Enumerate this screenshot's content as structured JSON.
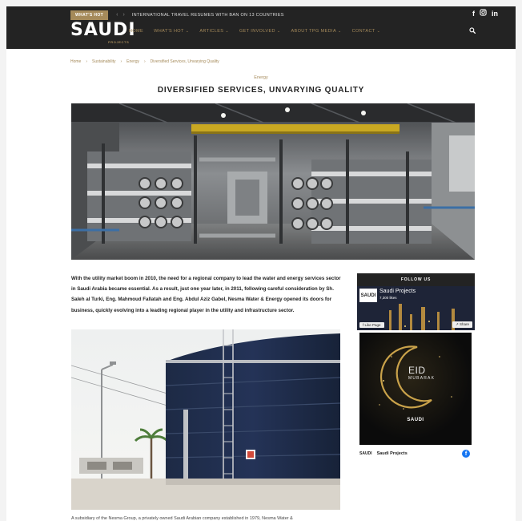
{
  "header": {
    "hot_badge": "WHAT'S HOT",
    "ticker_text": "INTERNATIONAL TRAVEL RESUMES WITH BAN ON 13 COUNTRIES",
    "logo_text": "SAUDI",
    "logo_sub": "PROJECTS",
    "nav": [
      {
        "label": "HOME",
        "has_dropdown": false
      },
      {
        "label": "WHAT'S HOT",
        "has_dropdown": true
      },
      {
        "label": "ARTICLES",
        "has_dropdown": true
      },
      {
        "label": "GET INVOLVED",
        "has_dropdown": true
      },
      {
        "label": "ABOUT TPG MEDIA",
        "has_dropdown": true
      },
      {
        "label": "CONTACT",
        "has_dropdown": true
      }
    ],
    "social_icons": [
      "facebook-icon",
      "instagram-icon",
      "linkedin-icon"
    ]
  },
  "breadcrumb": [
    "Home",
    "Sustainability",
    "Energy",
    "Diversified Services, Unvarying Quality"
  ],
  "article": {
    "category": "Energy",
    "title": "DIVERSIFIED SERVICES, UNVARYING QUALITY",
    "lead": "With the utility market boom in 2010, the need for a regional company to lead the water and energy services sector in Saudi Arabia became essential. As a result, just one year later, in 2011, following careful consideration by Sh. Saleh al Turki, Eng. Mahmoud Fallatah and Eng. Abdul Aziz Gabel, Nesma Water & Energy opened its doors for business, quickly evolving into a leading regional player in the utility and infrastructure sector.",
    "next_paragraph": "A subsidiary of the Nesma Group, a privately owned Saudi Arabian company established in 1979, Nesma Water &"
  },
  "sidebar": {
    "follow_title": "FOLLOW US",
    "fb_page_name": "Saudi Projects",
    "fb_likes": "7,300 likes",
    "fb_like_label": "Like Page",
    "fb_share_label": "Share",
    "fb_pic_text": "SAUDI",
    "eid_title": "EID",
    "eid_sub": "MUBARAK",
    "eid_brand": "SAUDI",
    "footer_logo": "SAUDI",
    "footer_name": "Saudi Projects"
  },
  "colors": {
    "accent": "#a58a5a",
    "header_bg": "#232323",
    "facebook_blue": "#1877f2"
  }
}
